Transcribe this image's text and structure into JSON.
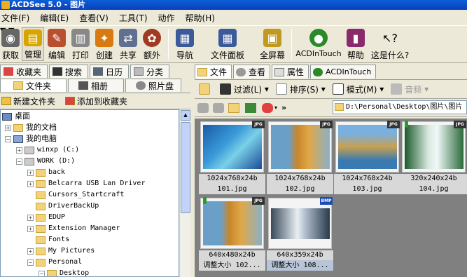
{
  "app": {
    "title": "ACDSee 5.0 - 图片"
  },
  "menu": [
    "文件(F)",
    "编辑(E)",
    "查看(V)",
    "工具(T)",
    "动作",
    "帮助(H)"
  ],
  "toolbar": {
    "acquire": "获取",
    "manage": "管理",
    "edit": "编辑",
    "print": "打印",
    "create": "创建",
    "share": "共享",
    "extra": "额外",
    "navigate": "导航",
    "file_panel": "文件面板",
    "fullscreen": "全屏幕",
    "acdintouch": "ACDInTouch",
    "help": "帮助",
    "whats_this": "这是什么?"
  },
  "left_tabs_row1": [
    "收藏夹",
    "搜索",
    "日历",
    "分类"
  ],
  "left_tabs_row2": [
    "文件夹",
    "相册",
    "照片盘"
  ],
  "left_actions": {
    "new_folder": "新建文件夹",
    "add_fav": "添加到收藏夹"
  },
  "tree": {
    "desktop": "桌面",
    "my_docs": "我的文档",
    "my_computer": "我的电脑",
    "winxp": "winxp (C:)",
    "work": "WORK (D:)",
    "folders": [
      "back",
      "Belcarra USB Lan Driver",
      "Cursors_Startcraft",
      "DriverBackUp",
      "EDUP",
      "Extension Manager",
      "Fonts",
      "My Pictures",
      "Personal",
      "Desktop"
    ]
  },
  "right_tabs": [
    "文件",
    "查看",
    "属性",
    "ACDInTouch"
  ],
  "right_toolbar": {
    "filter": "过滤(L)",
    "sort": "排序(S)",
    "mode": "模式(M)",
    "audio": "音频"
  },
  "path": "D:\\Personal\\Desktop\\图片\\图片",
  "thumbnails": [
    {
      "dims": "1024x768x24b",
      "name": "101.jpg",
      "type": "JPG"
    },
    {
      "dims": "1024x768x24b",
      "name": "102.jpg",
      "type": "JPG"
    },
    {
      "dims": "1024x768x24b",
      "name": "103.jpg",
      "type": "JPG"
    },
    {
      "dims": "320x240x24b",
      "name": "104.jpg",
      "type": "JPG"
    },
    {
      "dims": "640x480x24b",
      "name": "调整大小 102...",
      "type": "JPG"
    },
    {
      "dims": "640x359x24b",
      "name": "调整大小 108...",
      "type": "BMP"
    }
  ]
}
